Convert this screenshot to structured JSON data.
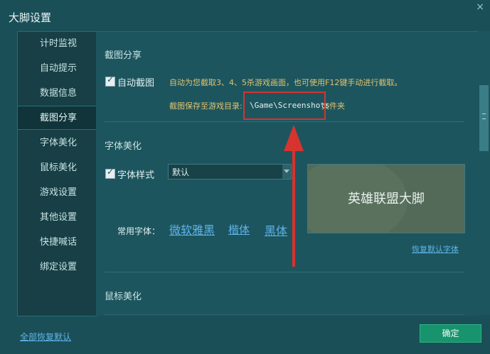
{
  "window": {
    "title": "大脚设置",
    "close_label": "×"
  },
  "sidebar": {
    "items": [
      {
        "label": "计时监视"
      },
      {
        "label": "自动提示"
      },
      {
        "label": "数据信息"
      },
      {
        "label": "截图分享"
      },
      {
        "label": "字体美化"
      },
      {
        "label": "鼠标美化"
      },
      {
        "label": "游戏设置"
      },
      {
        "label": "其他设置"
      },
      {
        "label": "快捷喊话"
      },
      {
        "label": "绑定设置"
      }
    ],
    "active_item": "截图分享"
  },
  "screenshot_section": {
    "title": "截图分享",
    "auto_screenshot": {
      "label": "自动截图",
      "checked": true
    },
    "hint": "自动为您截取3、4、5杀游戏画面，也可使用F12键手动进行截取。",
    "save_prefix": "截图保存至游戏目录:",
    "save_path": "\\Game\\Screenshots",
    "save_suffix": " 文件夹"
  },
  "font_section": {
    "title": "字体美化",
    "font_style": {
      "label": "字体样式",
      "checked": true,
      "selected": "默认"
    },
    "preview_text": "英雄联盟大脚",
    "common_fonts_label": "常用字体：",
    "common_fonts": [
      "微软雅黑",
      "楷体",
      "黑体"
    ],
    "restore_default_font": "恢复默认字体"
  },
  "mouse_section": {
    "title": "鼠标美化"
  },
  "footer": {
    "restore_all": "全部恢复默认",
    "ok": "确定"
  },
  "colors": {
    "accent": "#17936d",
    "link": "#5fb4ea",
    "annotation": "#d7332f"
  }
}
